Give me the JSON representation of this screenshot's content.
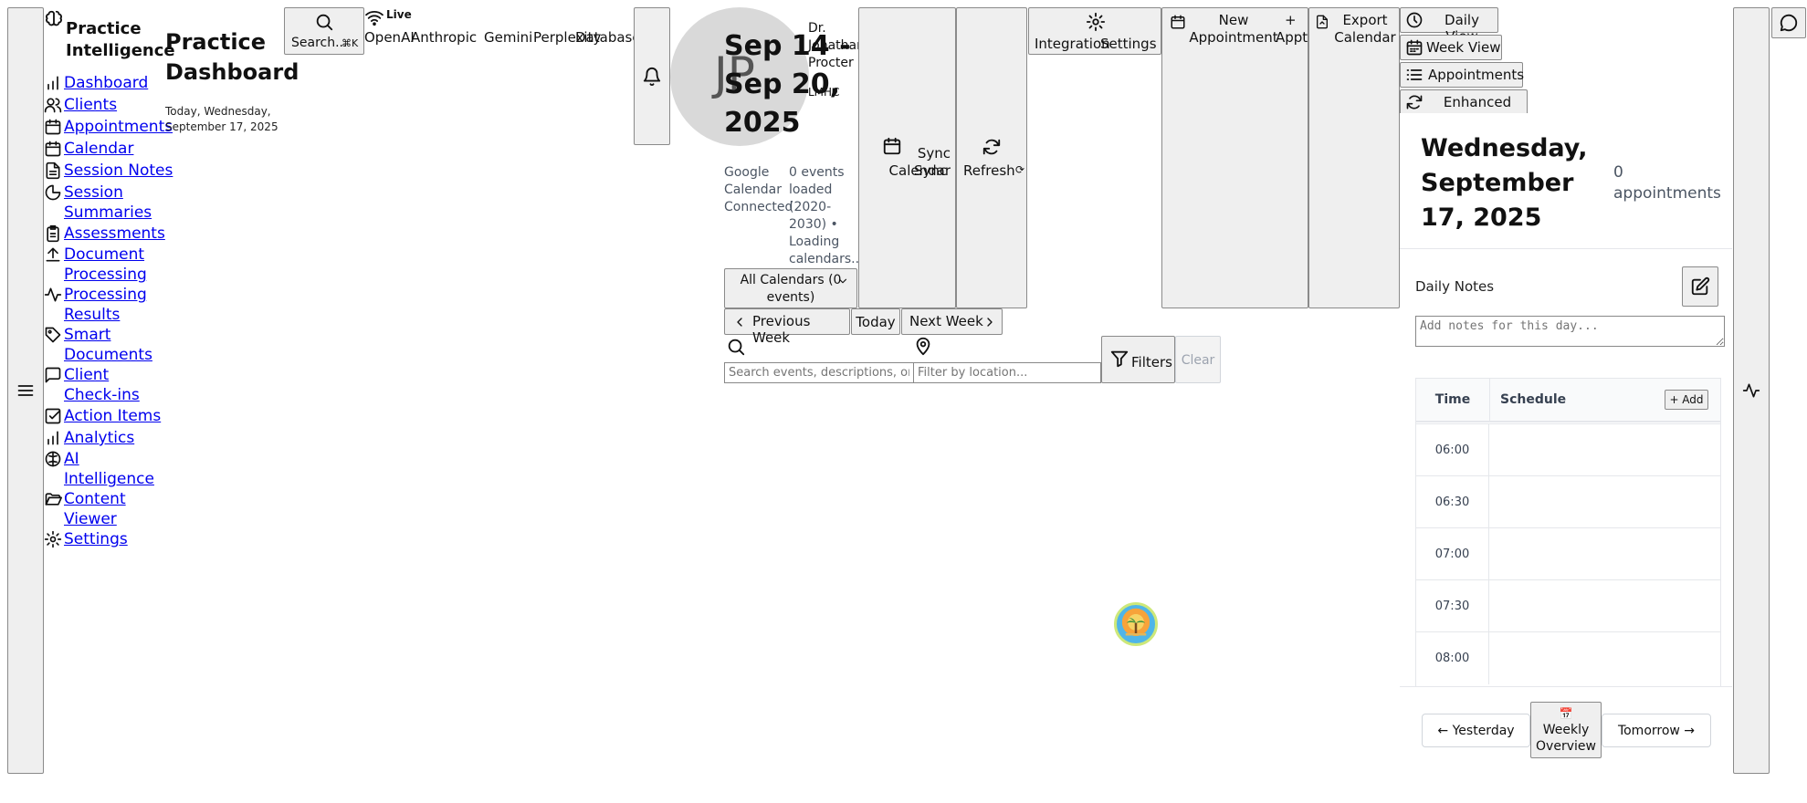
{
  "brand": {
    "name": "Practice Intelligence",
    "icon": "brain-icon"
  },
  "sidebar": {
    "items": [
      {
        "label": "Dashboard",
        "icon": "bar-chart-icon"
      },
      {
        "label": "Clients",
        "icon": "users-icon"
      },
      {
        "label": "Appointments",
        "icon": "calendar-icon"
      },
      {
        "label": "Calendar",
        "icon": "calendar-icon"
      },
      {
        "label": "Session Notes",
        "icon": "file-text-icon"
      },
      {
        "label": "Session Summaries",
        "icon": "pie-chart-icon"
      },
      {
        "label": "Assessments",
        "icon": "clipboard-icon"
      },
      {
        "label": "Document Processing",
        "icon": "upload-icon"
      },
      {
        "label": "Processing Results",
        "icon": "activity-icon"
      },
      {
        "label": "Smart Documents",
        "icon": "tag-icon"
      },
      {
        "label": "Client Check-ins",
        "icon": "message-square-icon"
      },
      {
        "label": "Action Items",
        "icon": "check-square-icon"
      },
      {
        "label": "Analytics",
        "icon": "bar-chart-icon"
      },
      {
        "label": "AI Intelligence",
        "icon": "brain-icon"
      },
      {
        "label": "Content Viewer",
        "icon": "folder-open-icon"
      },
      {
        "label": "Settings",
        "icon": "gear-icon"
      }
    ]
  },
  "header": {
    "title": "Practice Dashboard",
    "date": "Today, Wednesday, September 17, 2025",
    "search_label": "Search...",
    "search_shortcut": "⌘K",
    "status_label": "Live",
    "ai_services": [
      "OpenAI",
      "Anthropic",
      "Gemini",
      "Perplexity",
      "Database"
    ],
    "avatar_initials": "JP",
    "user_name": "Dr. Jonathan Procter",
    "user_credentials": "LMHC"
  },
  "calendar": {
    "range": "Sep 14 - Sep 20, 2025",
    "connection_status": "Google Calendar Connected",
    "events_status": "0 events loaded (2020-2030) • Loading calendars...",
    "calendar_select": "All Calendars (0 events)",
    "sync_label": "Sync Calendar",
    "sync_suffix": "Sync",
    "refresh_label": "Refresh",
    "refresh_suffix": "⟳",
    "integration_label": "Integration",
    "settings_label": "Settings",
    "new_appointment_label": "New Appointment",
    "new_appt_plus": "+",
    "new_appt_short": "Appt",
    "export_label": "Export Calendar",
    "prev_week": "Previous Week",
    "today": "Today",
    "next_week": "Next Week",
    "search_placeholder": "Search events, descriptions, or c",
    "location_placeholder": "Filter by location...",
    "filters_label": "Filters",
    "clear_label": "Clear"
  },
  "views": {
    "daily": "Daily View",
    "week": "Week View",
    "appointments": "Appointments",
    "enhanced_sync": "Enhanced Sync"
  },
  "day": {
    "title": "Wednesday, September 17, 2025",
    "count": "0 appointments",
    "notes_label": "Daily Notes",
    "notes_placeholder": "Add notes for this day...",
    "col_time": "Time",
    "col_schedule": "Schedule",
    "add_label": "+ Add",
    "times": [
      "06:00",
      "06:30",
      "07:00",
      "07:30",
      "08:00"
    ],
    "yesterday": "← Yesterday",
    "weekly_icon": "📅",
    "weekly_overview": "Weekly Overview",
    "tomorrow": "Tomorrow →"
  }
}
